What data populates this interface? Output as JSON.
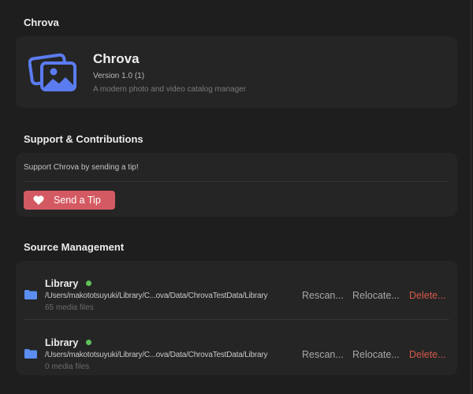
{
  "about": {
    "section_title": "Chrova",
    "app_name": "Chrova",
    "version": "Version 1.0 (1)",
    "description": "A modern photo and video catalog manager"
  },
  "support": {
    "section_title": "Support & Contributions",
    "text": "Support Chrova by sending a tip!",
    "button_label": "Send a Tip"
  },
  "sources": {
    "section_title": "Source Management",
    "items": [
      {
        "name": "Library",
        "path": "/Users/makototsuyuki/Library/C...ova/Data/ChrovaTestData/Library",
        "count": "65 media files",
        "rescan": "Rescan...",
        "relocate": "Relocate...",
        "delete": "Delete..."
      },
      {
        "name": "Library",
        "path": "/Users/makototsuyuki/Library/C...ova/Data/ChrovaTestData/Library",
        "count": "0 media files",
        "rescan": "Rescan...",
        "relocate": "Relocate...",
        "delete": "Delete..."
      }
    ]
  },
  "colors": {
    "accent": "#5b7cf0",
    "tip": "#d35a62",
    "status": "#5fc35a",
    "delete": "#d65a4a"
  }
}
